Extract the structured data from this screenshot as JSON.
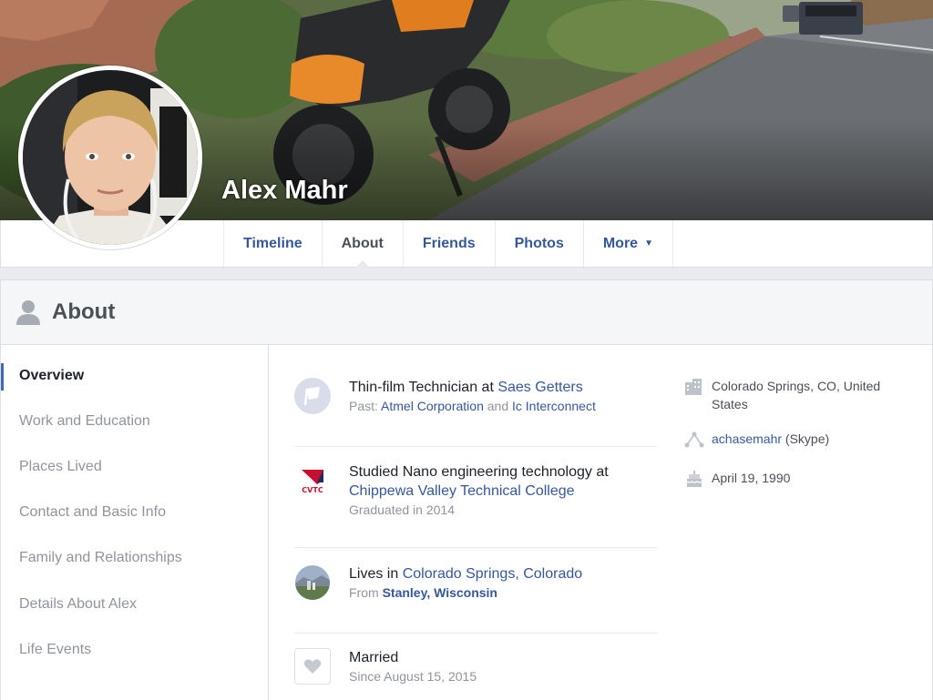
{
  "profile": {
    "name": "Alex Mahr"
  },
  "nav": {
    "tabs": [
      {
        "label": "Timeline"
      },
      {
        "label": "About"
      },
      {
        "label": "Friends"
      },
      {
        "label": "Photos"
      },
      {
        "label": "More"
      }
    ],
    "more_caret": "▼"
  },
  "about": {
    "title": "About",
    "sidebar": [
      {
        "label": "Overview"
      },
      {
        "label": "Work and Education"
      },
      {
        "label": "Places Lived"
      },
      {
        "label": "Contact and Basic Info"
      },
      {
        "label": "Family and Relationships"
      },
      {
        "label": "Details About Alex"
      },
      {
        "label": "Life Events"
      }
    ],
    "work": {
      "prefix": "Thin-film Technician at ",
      "company": "Saes Getters",
      "past_label": "Past: ",
      "past_1": "Atmel Corporation",
      "and": " and ",
      "past_2": "Ic Interconnect"
    },
    "education": {
      "prefix": "Studied Nano engineering technology at",
      "school": "Chippewa Valley Technical College",
      "graduated": "Graduated in 2014",
      "logo_text": "CVTC"
    },
    "lives": {
      "prefix": "Lives in ",
      "city": "Colorado Springs, Colorado",
      "from_label": "From ",
      "from_city": "Stanley, Wisconsin"
    },
    "relationship": {
      "status": "Married",
      "since": "Since August 15, 2015"
    },
    "right": {
      "location": "Colorado Springs, CO, United States",
      "skype_name": "achasemahr",
      "skype_label": " (Skype)",
      "birthday": "April 19, 1990"
    }
  },
  "colors": {
    "link": "#365899",
    "text": "#1d2129",
    "muted": "#90949c",
    "accent": "#4267b2",
    "cvtc_red": "#c8102e"
  },
  "icons": {
    "work": "flag-icon",
    "education": "cvtc-logo-icon",
    "lives": "city-photo-icon",
    "relationship": "heart-icon",
    "location": "building-icon",
    "skype": "share-icon",
    "birthday": "cake-icon",
    "about": "person-icon"
  }
}
